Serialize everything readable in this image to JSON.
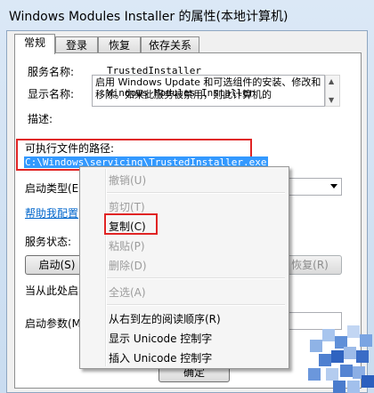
{
  "window": {
    "title": "Windows Modules Installer 的属性(本地计算机)"
  },
  "tabs": [
    {
      "label": "常规",
      "active": true
    },
    {
      "label": "登录",
      "active": false
    },
    {
      "label": "恢复",
      "active": false
    },
    {
      "label": "依存关系",
      "active": false
    }
  ],
  "general": {
    "service_name_label": "服务名称:",
    "service_name_value": "TrustedInstaller",
    "display_name_label": "显示名称:",
    "display_name_value": "Windows Modules Installer",
    "description_label": "描述:",
    "description_value": "启用 Windows Update 和可选组件的安装、修改和移除。如果此服务被禁用，则此计算机的",
    "path_label": "可执行文件的路径:",
    "path_value": "C:\\Windows\\servicing\\TrustedInstaller.exe",
    "startup_type_label": "启动类型(E",
    "help_link": "帮助我配置",
    "service_status_label": "服务状态:",
    "start_button": "启动(S)",
    "resume_button": "恢复(R)",
    "start_params_hint": "当从此处启",
    "start_params_label": "启动参数(M",
    "ok_button": "确定"
  },
  "context_menu": {
    "items": [
      {
        "label": "撤销(U)",
        "enabled": false
      },
      {
        "label": "剪切(T)",
        "enabled": false
      },
      {
        "label": "复制(C)",
        "enabled": true,
        "highlighted": true
      },
      {
        "label": "粘贴(P)",
        "enabled": false
      },
      {
        "label": "删除(D)",
        "enabled": false
      },
      {
        "label": "全选(A)",
        "enabled": false
      },
      {
        "label": "从右到左的阅读顺序(R)",
        "enabled": true
      },
      {
        "label": "显示 Unicode 控制字",
        "enabled": true
      },
      {
        "label": "插入 Unicode 控制字",
        "enabled": true
      }
    ]
  },
  "colors": {
    "highlight_border": "#e02424",
    "selection": "#3399ff",
    "link": "#0066cc"
  }
}
